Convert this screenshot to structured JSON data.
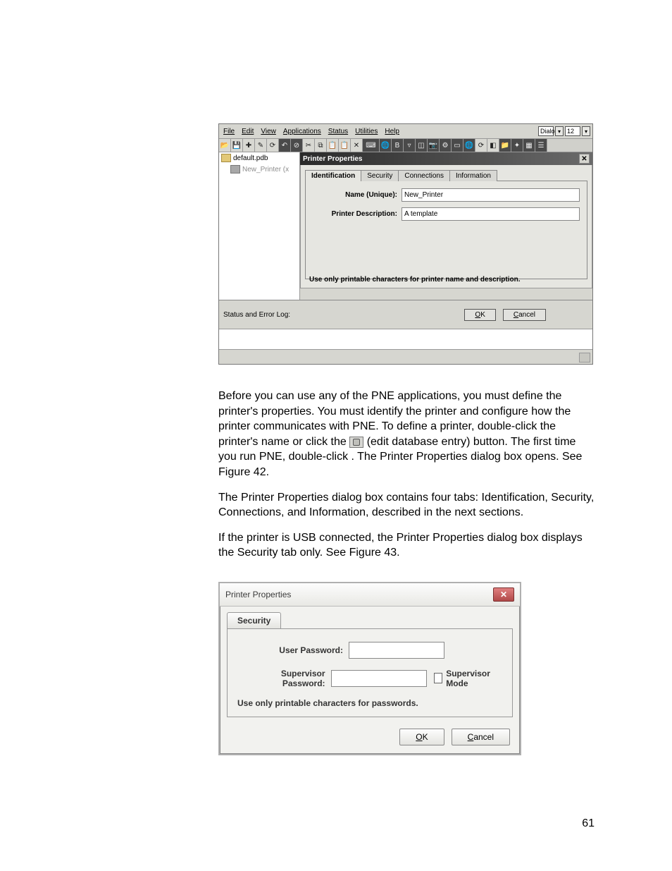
{
  "screenshot": {
    "menus": [
      "File",
      "Edit",
      "View",
      "Applications",
      "Status",
      "Utilities",
      "Help"
    ],
    "font_combo_label": "Dialog",
    "size_combo": "12",
    "tree": {
      "root": "default.pdb",
      "child": "New_Printer (x"
    },
    "dialog": {
      "title": "Printer Properties",
      "tabs": [
        "Identification",
        "Security",
        "Connections",
        "Information"
      ],
      "name_label": "Name (Unique):",
      "name_value": "New_Printer",
      "desc_label": "Printer Description:",
      "desc_value": "A template",
      "hint": "Use only printable characters for printer name and description.",
      "ok": "OK",
      "cancel": "Cancel"
    },
    "status_label": "Status and Error Log:"
  },
  "body": {
    "p1a": "Before you can use any of the PNE applications, you must define the printer's properties. You must identify the printer and configure how the printer communicates with PNE. To define a printer, double-click the printer's name or click the ",
    "p1b": " (edit database entry) button. The first time you run PNE, double-click",
    "p1c": ". The Printer Properties dialog box opens. See Figure 42.",
    "p2": "The Printer Properties dialog box contains four tabs: Identification, Security, Connections, and Information, described in the next sections.",
    "p3": "If the printer is USB connected, the Printer Properties dialog box displays the Security tab only.  See Figure 43."
  },
  "secdlg": {
    "title": "Printer Properties",
    "tab": "Security",
    "user_label": "User Password:",
    "sup_label": "Supervisor Password:",
    "sup_mode": "Supervisor Mode",
    "hint": "Use only printable characters for passwords.",
    "ok": "OK",
    "cancel": "Cancel"
  },
  "page_number": "61"
}
